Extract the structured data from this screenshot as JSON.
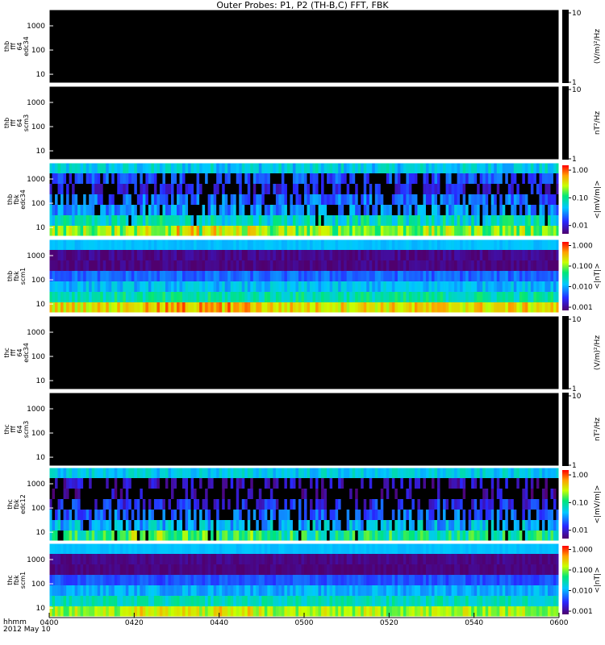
{
  "chart_data": {
    "type": "heatmap",
    "title": "Outer Probes: P1, P2 (TH-B,C) FFT, FBK",
    "x": {
      "ticks": [
        "0400",
        "0420",
        "0440",
        "0500",
        "0520",
        "0540",
        "0600"
      ],
      "label": "hhmm",
      "date": "2012 May 10",
      "range": [
        "0400",
        "0600"
      ]
    },
    "panels": [
      {
        "ylabel": [
          "thb",
          "fff",
          "64",
          "edc34"
        ],
        "yticks": [
          "1000",
          "100",
          "10"
        ],
        "yscale": "log",
        "zlabel": "(V/m)²/Hz",
        "zticks": [
          "10",
          "1"
        ],
        "colorbar": "dark",
        "data": "no data"
      },
      {
        "ylabel": [
          "thb",
          "fff",
          "64",
          "scm3"
        ],
        "yticks": [
          "1000",
          "100",
          "10"
        ],
        "yscale": "log",
        "zlabel": "nT²/Hz",
        "zticks": [
          "10",
          "1"
        ],
        "colorbar": "dark",
        "data": "no data"
      },
      {
        "ylabel": [
          "thb",
          "fbk",
          "edc34"
        ],
        "yticks": [
          "1000",
          "100",
          "10"
        ],
        "yscale": "log",
        "zlabel": "<|mV/m|>",
        "zticks": [
          "1.00",
          "0.10",
          "0.01"
        ],
        "zrange": [
          0.005,
          1.5
        ],
        "colorbar": "rainbow",
        "bands": [
          {
            "level": 0.05,
            "var": 0.25
          },
          {
            "level": 0.018,
            "var": 0.2,
            "blackProb": 0.35
          },
          {
            "level": 0.012,
            "var": 0.2,
            "blackProb": 0.5
          },
          {
            "level": 0.022,
            "var": 0.25,
            "blackProb": 0.25
          },
          {
            "level": 0.03,
            "var": 0.25,
            "blackProb": 0.2
          },
          {
            "level": 0.07,
            "var": 0.3,
            "blackProb": 0.05
          },
          {
            "level": 0.2,
            "var": 0.3
          }
        ]
      },
      {
        "ylabel": [
          "thb",
          "fbk",
          "scm1"
        ],
        "yticks": [
          "1000",
          "100",
          "10"
        ],
        "yscale": "log",
        "zlabel": "<|nT|>",
        "zticks": [
          "1.000",
          "0.100",
          "0.010",
          "0.001"
        ],
        "zrange": [
          0.0007,
          1.5
        ],
        "colorbar": "rainbow",
        "bands": [
          {
            "level": 0.012,
            "var": 0.08
          },
          {
            "level": 0.0009,
            "var": 0.15
          },
          {
            "level": 0.0008,
            "var": 0.15
          },
          {
            "level": 0.005,
            "var": 0.2
          },
          {
            "level": 0.012,
            "var": 0.25
          },
          {
            "level": 0.03,
            "var": 0.3
          },
          {
            "level": 0.25,
            "var": 0.35
          }
        ]
      },
      {
        "ylabel": [
          "thc",
          "fff",
          "64",
          "edc34"
        ],
        "yticks": [
          "1000",
          "100",
          "10"
        ],
        "yscale": "log",
        "zlabel": "(V/m)²/Hz",
        "zticks": [
          "10",
          "1"
        ],
        "colorbar": "dark",
        "data": "no data"
      },
      {
        "ylabel": [
          "thc",
          "fff",
          "64",
          "scm3"
        ],
        "yticks": [
          "1000",
          "100",
          "10"
        ],
        "yscale": "log",
        "zlabel": "nT²/Hz",
        "zticks": [
          "10",
          "1"
        ],
        "colorbar": "dark",
        "data": "no data"
      },
      {
        "ylabel": [
          "thc",
          "fbk",
          "edc12"
        ],
        "yticks": [
          "1000",
          "100",
          "10"
        ],
        "yscale": "log",
        "zlabel": "<|mV/m|>",
        "zticks": [
          "1.00",
          "0.10",
          "0.01"
        ],
        "zrange": [
          0.005,
          1.5
        ],
        "colorbar": "rainbow",
        "bands": [
          {
            "level": 0.05,
            "var": 0.2
          },
          {
            "level": 0.009,
            "var": 0.2,
            "blackProb": 0.6
          },
          {
            "level": 0.008,
            "var": 0.2,
            "blackProb": 0.7
          },
          {
            "level": 0.013,
            "var": 0.25,
            "blackProb": 0.45
          },
          {
            "level": 0.022,
            "var": 0.25,
            "blackProb": 0.35
          },
          {
            "level": 0.04,
            "var": 0.3,
            "blackProb": 0.2
          },
          {
            "level": 0.1,
            "var": 0.3,
            "blackProb": 0.05
          }
        ]
      },
      {
        "ylabel": [
          "thc",
          "fbk",
          "scm1"
        ],
        "yticks": [
          "1000",
          "100",
          "10"
        ],
        "yscale": "log",
        "zlabel": "<|nT|>",
        "zticks": [
          "1.000",
          "0.100",
          "0.010",
          "0.001"
        ],
        "zrange": [
          0.0007,
          1.5
        ],
        "colorbar": "rainbow",
        "bands": [
          {
            "level": 0.012,
            "var": 0.05
          },
          {
            "level": 0.0009,
            "var": 0.1
          },
          {
            "level": 0.0008,
            "var": 0.1
          },
          {
            "level": 0.004,
            "var": 0.15
          },
          {
            "level": 0.01,
            "var": 0.2
          },
          {
            "level": 0.025,
            "var": 0.25
          },
          {
            "level": 0.12,
            "var": 0.3
          }
        ]
      }
    ]
  }
}
